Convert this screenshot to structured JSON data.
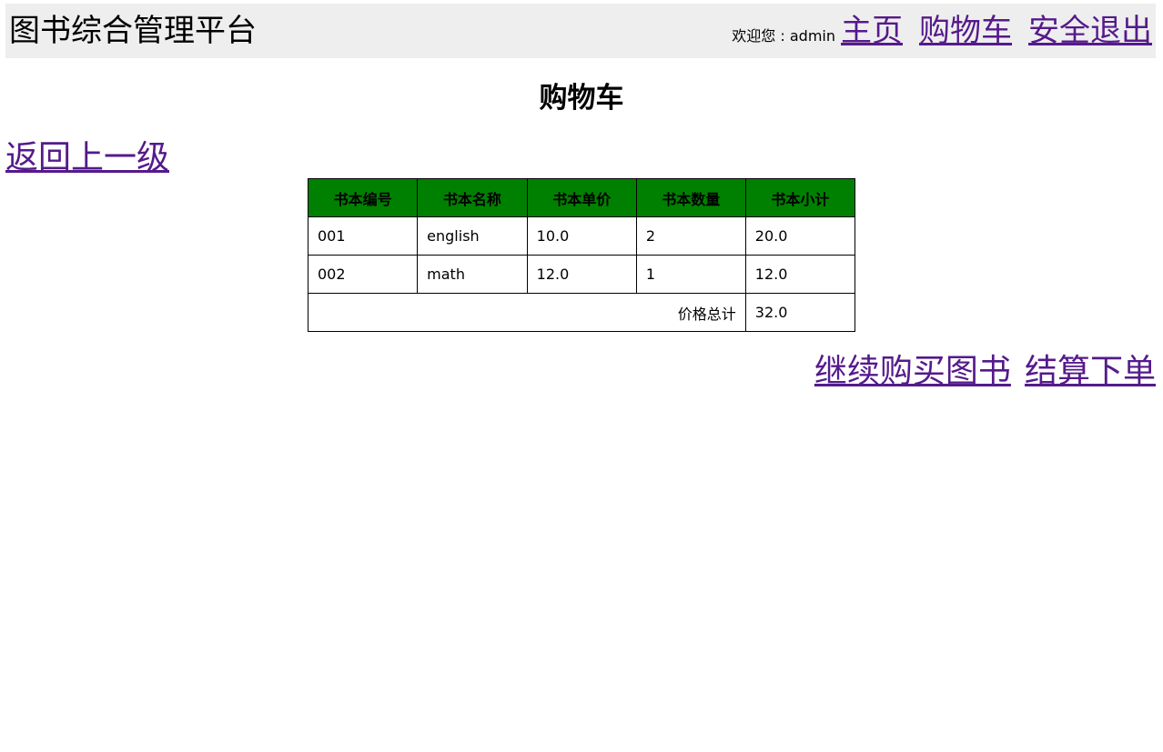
{
  "header": {
    "site_title": "图书综合管理平台",
    "welcome_text": "欢迎您 : admin",
    "nav": {
      "home": "主页",
      "cart": "购物车",
      "logout": "安全退出"
    }
  },
  "main": {
    "heading": "购物车",
    "back_link": "返回上一级",
    "table": {
      "header_color": "#008000",
      "columns": [
        "书本编号",
        "书本名称",
        "书本单价",
        "书本数量",
        "书本小计"
      ],
      "rows": [
        [
          "001",
          "english",
          "10.0",
          "2",
          "20.0"
        ],
        [
          "002",
          "math",
          "12.0",
          "1",
          "12.0"
        ]
      ],
      "total_label": "价格总计",
      "total_value": "32.0"
    },
    "actions": {
      "continue_shopping": "继续购买图书",
      "checkout": "结算下单"
    }
  },
  "colors": {
    "link": "#551a8b",
    "header_bg": "#eeeeee"
  }
}
